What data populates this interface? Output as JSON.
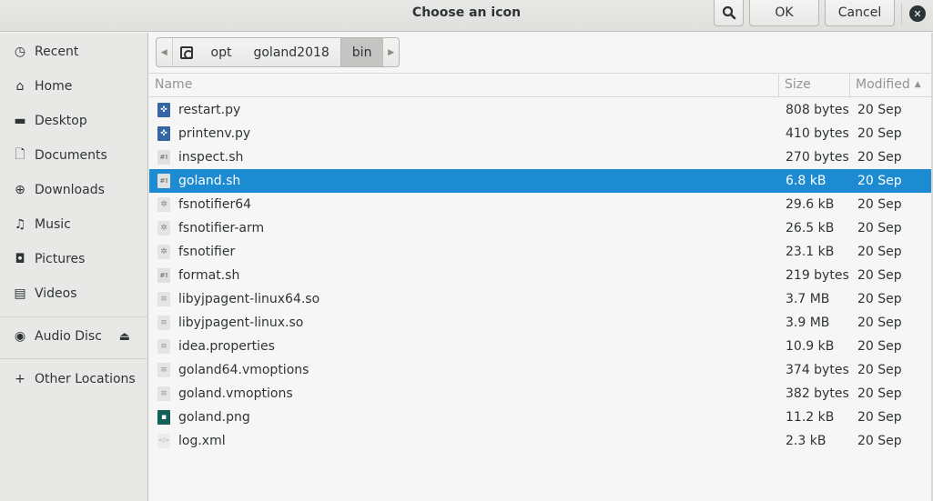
{
  "window": {
    "title": "Choose an icon",
    "search_icon": "search-icon",
    "ok_label": "OK",
    "cancel_label": "Cancel",
    "close_glyph": "✕"
  },
  "sidebar": {
    "items": [
      {
        "label": "Recent",
        "icon": "recent-icon",
        "glyph": "◷"
      },
      {
        "label": "Home",
        "icon": "home-icon",
        "glyph": "⌂"
      },
      {
        "label": "Desktop",
        "icon": "folder-icon",
        "glyph": "▬"
      },
      {
        "label": "Documents",
        "icon": "document-icon",
        "glyph": "🗋"
      },
      {
        "label": "Downloads",
        "icon": "download-icon",
        "glyph": "⊕"
      },
      {
        "label": "Music",
        "icon": "music-icon",
        "glyph": "♫"
      },
      {
        "label": "Pictures",
        "icon": "pictures-icon",
        "glyph": "◘"
      },
      {
        "label": "Videos",
        "icon": "videos-icon",
        "glyph": "▤"
      }
    ],
    "devices": [
      {
        "label": "Audio Disc",
        "icon": "disc-icon",
        "glyph": "◉",
        "eject_glyph": "⏏"
      }
    ],
    "other": {
      "label": "Other Locations",
      "icon": "plus-icon",
      "glyph": "+"
    }
  },
  "pathbar": {
    "left_arrow": "◀",
    "right_arrow": "▶",
    "root_icon": "disk-icon",
    "segments": [
      "opt",
      "goland2018",
      "bin"
    ],
    "active": "bin"
  },
  "list": {
    "columns": {
      "name": "Name",
      "size": "Size",
      "modified": "Modified",
      "sort_glyph": "▲"
    },
    "selected_index": 3,
    "rows": [
      {
        "name": "restart.py",
        "size": "808 bytes",
        "modified": "20 Sep",
        "type": "py",
        "glyph": "✜"
      },
      {
        "name": "printenv.py",
        "size": "410 bytes",
        "modified": "20 Sep",
        "type": "py",
        "glyph": "✜"
      },
      {
        "name": "inspect.sh",
        "size": "270 bytes",
        "modified": "20 Sep",
        "type": "sh",
        "glyph": "#!"
      },
      {
        "name": "goland.sh",
        "size": "6.8 kB",
        "modified": "20 Sep",
        "type": "sh",
        "glyph": "#!"
      },
      {
        "name": "fsnotifier64",
        "size": "29.6 kB",
        "modified": "20 Sep",
        "type": "exe",
        "glyph": "✲"
      },
      {
        "name": "fsnotifier-arm",
        "size": "26.5 kB",
        "modified": "20 Sep",
        "type": "exe",
        "glyph": "✲"
      },
      {
        "name": "fsnotifier",
        "size": "23.1 kB",
        "modified": "20 Sep",
        "type": "exe",
        "glyph": "✲"
      },
      {
        "name": "format.sh",
        "size": "219 bytes",
        "modified": "20 Sep",
        "type": "sh",
        "glyph": "#!"
      },
      {
        "name": "libyjpagent-linux64.so",
        "size": "3.7 MB",
        "modified": "20 Sep",
        "type": "txt",
        "glyph": "≡"
      },
      {
        "name": "libyjpagent-linux.so",
        "size": "3.9 MB",
        "modified": "20 Sep",
        "type": "txt",
        "glyph": "≡"
      },
      {
        "name": "idea.properties",
        "size": "10.9 kB",
        "modified": "20 Sep",
        "type": "txt",
        "glyph": "≡"
      },
      {
        "name": "goland64.vmoptions",
        "size": "374 bytes",
        "modified": "20 Sep",
        "type": "txt",
        "glyph": "≡"
      },
      {
        "name": "goland.vmoptions",
        "size": "382 bytes",
        "modified": "20 Sep",
        "type": "txt",
        "glyph": "≡"
      },
      {
        "name": "goland.png",
        "size": "11.2 kB",
        "modified": "20 Sep",
        "type": "img",
        "glyph": "▪"
      },
      {
        "name": "log.xml",
        "size": "2.3 kB",
        "modified": "20 Sep",
        "type": "xml",
        "glyph": "</>"
      }
    ]
  },
  "colors": {
    "selection": "#1c8bd1",
    "python_icon": "#3465a4",
    "image_icon": "#12605a"
  }
}
